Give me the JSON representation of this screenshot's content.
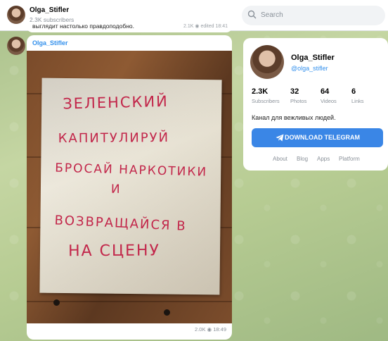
{
  "header": {
    "channel_name": "Olga_Stifler",
    "subscribers": "2.3K subscribers",
    "search_placeholder": "Search"
  },
  "previous_message": {
    "text": "выглядит настолько правдоподобно.",
    "views": "2.1K",
    "edited": "edited 18:41"
  },
  "post": {
    "author": "Olga_Stifler",
    "photo_lines": [
      "ЗЕЛЕНСКИЙ",
      "КАПИТУЛИРУЙ",
      "БРОСАЙ НАРКОТИКИ",
      "И",
      "ВОЗВРАЩАЙСЯ В",
      "НА СЦЕНУ"
    ],
    "views": "2.0K",
    "time": "18:49"
  },
  "channel_card": {
    "name": "Olga_Stifler",
    "handle": "@olga_stifler",
    "stats": [
      {
        "value": "2.3K",
        "label": "Subscribers"
      },
      {
        "value": "32",
        "label": "Photos"
      },
      {
        "value": "64",
        "label": "Videos"
      },
      {
        "value": "6",
        "label": "Links"
      }
    ],
    "description": "Канал для вежливых людей.",
    "download_button": "DOWNLOAD TELEGRAM",
    "links": [
      "About",
      "Blog",
      "Apps",
      "Platform"
    ]
  },
  "colors": {
    "accent": "#3390ec",
    "button": "#3a86e6",
    "handwriting": "#c2264a"
  }
}
